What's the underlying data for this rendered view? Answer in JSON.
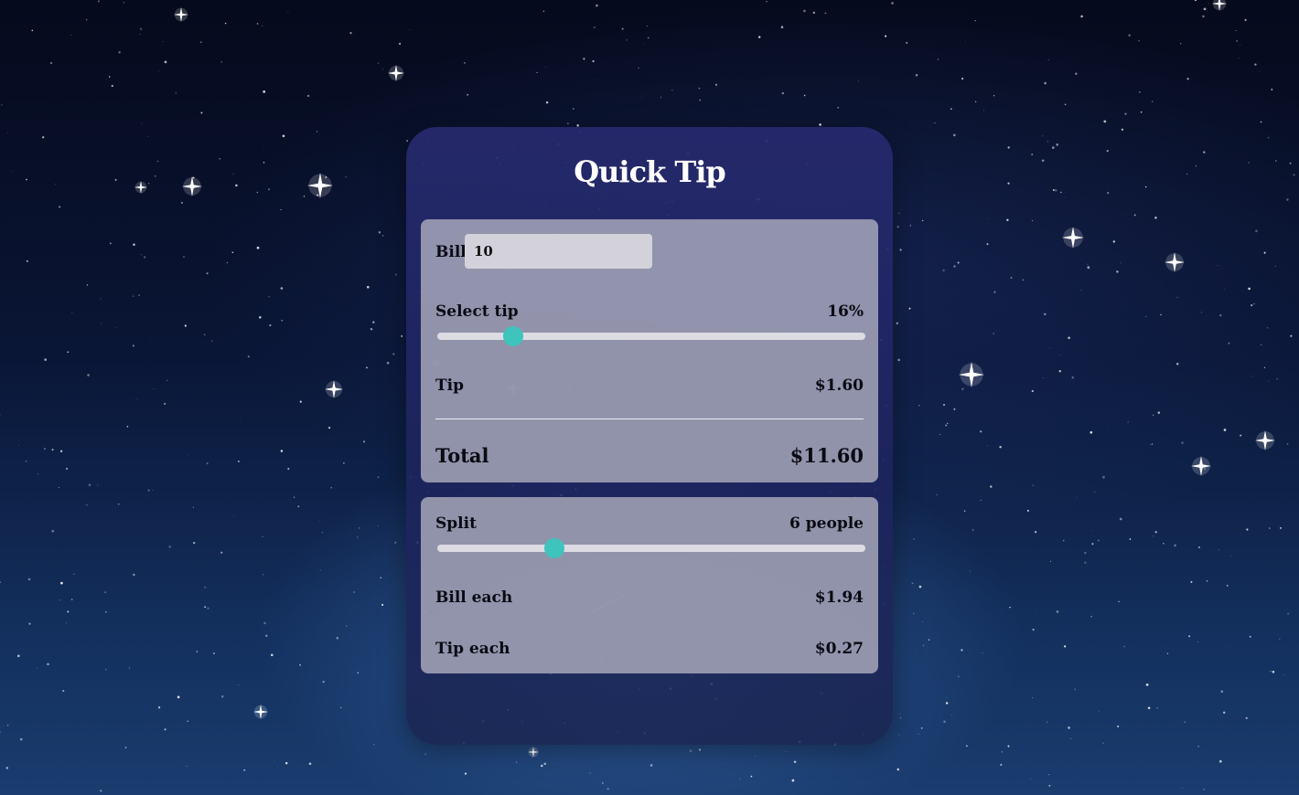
{
  "app": {
    "title": "Quick Tip"
  },
  "bill": {
    "label": "Bill",
    "value": "10"
  },
  "tip": {
    "select_label": "Select tip",
    "percent_text": "16%",
    "slider_fraction": 0.177,
    "tip_label": "Tip",
    "tip_amount": "$1.60",
    "total_label": "Total",
    "total_amount": "$11.60"
  },
  "split": {
    "label": "Split",
    "people_text": "6 people",
    "slider_fraction": 0.274,
    "bill_each_label": "Bill each",
    "bill_each_amount": "$1.94",
    "tip_each_label": "Tip each",
    "tip_each_amount": "$0.27"
  },
  "colors": {
    "accent": "#3ec3bd",
    "card": "#262a6e",
    "panel": "#b2b2c0"
  }
}
